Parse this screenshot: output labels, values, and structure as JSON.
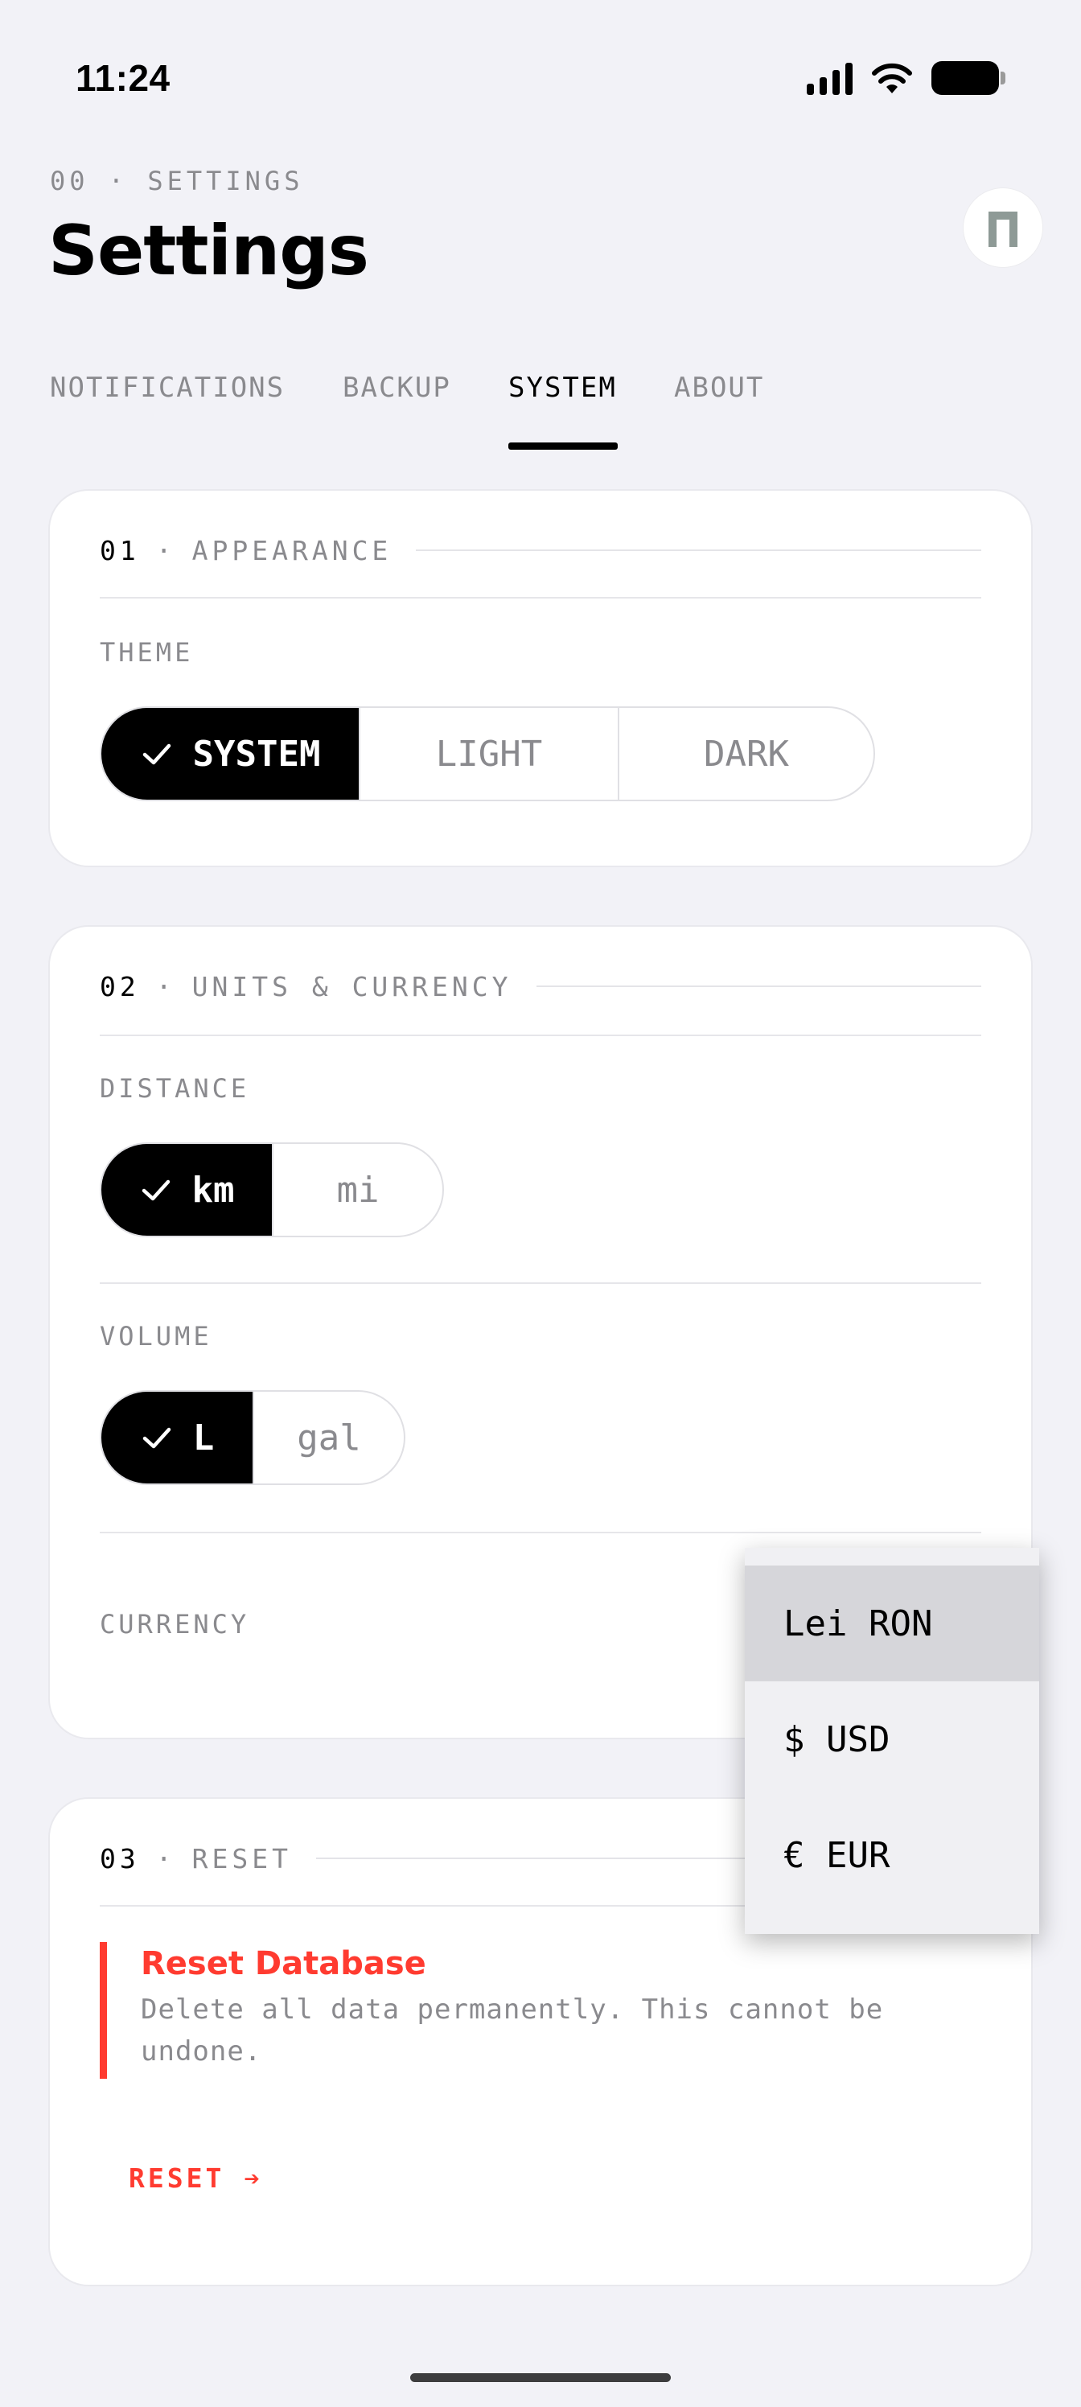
{
  "status_bar": {
    "time": "11:24",
    "icons": [
      "signal-icon",
      "wifi-icon",
      "battery-icon"
    ]
  },
  "header": {
    "eyebrow": "00 · SETTINGS",
    "title": "Settings",
    "avatar_icon": "app-logo-icon"
  },
  "tabs": [
    {
      "label": "NOTIFICATIONS",
      "active": false
    },
    {
      "label": "BACKUP",
      "active": false
    },
    {
      "label": "SYSTEM",
      "active": true
    },
    {
      "label": "ABOUT",
      "active": false
    }
  ],
  "appearance": {
    "num": "01",
    "dot": "·",
    "title": "APPEARANCE",
    "theme_label": "THEME",
    "theme_options": [
      "SYSTEM",
      "LIGHT",
      "DARK"
    ],
    "theme_selected": "SYSTEM"
  },
  "units": {
    "num": "02",
    "dot": "·",
    "title": "UNITS & CURRENCY",
    "distance_label": "DISTANCE",
    "distance_options": [
      "km",
      "mi"
    ],
    "distance_selected": "km",
    "volume_label": "VOLUME",
    "volume_options": [
      "L",
      "gal"
    ],
    "volume_selected": "L",
    "currency_label": "CURRENCY"
  },
  "reset": {
    "num": "03",
    "dot": "·",
    "title": "RESET",
    "box_title": "Reset Database",
    "box_desc_line1": "Delete all data permanently. This cannot be",
    "box_desc_line2": "undone.",
    "action": "RESET ➔"
  },
  "currency_dropdown": {
    "options": [
      "Lei RON",
      "$ USD",
      "€ EUR"
    ],
    "selected": "Lei RON"
  },
  "colors": {
    "accent": "#000000",
    "danger": "#ff3b30",
    "muted": "#8a8a8e",
    "background": "#f2f2f7"
  }
}
